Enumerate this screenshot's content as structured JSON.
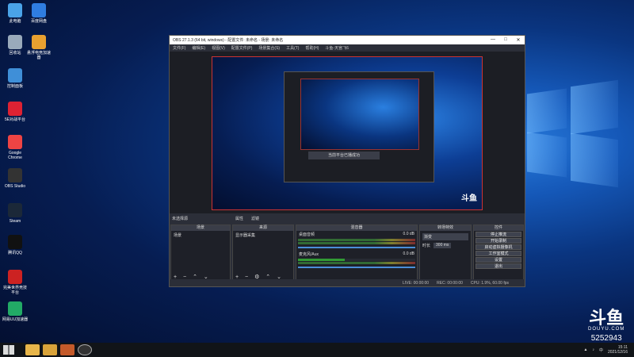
{
  "desktop_icons": [
    {
      "label": "此电脑",
      "color": "#4aa3e8"
    },
    {
      "label": "百度网盘",
      "color": "#2f7de1"
    },
    {
      "label": "回收站",
      "color": "#9ab"
    },
    {
      "label": "悬浮电竞加速器",
      "color": "#e8a030"
    },
    {
      "label": "控制面板",
      "color": "#3f8fd8"
    },
    {
      "label": "5E对战平台",
      "color": "#d23"
    },
    {
      "label": "Google Chrome",
      "color": "#e44"
    },
    {
      "label": "OBS Studio",
      "color": "#333"
    },
    {
      "label": "Steam",
      "color": "#1b2838"
    },
    {
      "label": "腾讯QQ",
      "color": "#111"
    },
    {
      "label": "完美世界竞技平台",
      "color": "#c22"
    },
    {
      "label": "网易UU加速器",
      "color": "#2a6"
    }
  ],
  "obs": {
    "title": "OBS 27.1.3 (64 bit, windows) - 配置文件: 未命名 - 场景: 未命名",
    "menu": [
      "文件(F)",
      "编辑(E)",
      "视图(V)",
      "配置文件(P)",
      "场景集合(S)",
      "工具(T)",
      "帮助(H)",
      "斗鱼-天宫飞6"
    ],
    "scene_bar": {
      "label": "未选择源",
      "props": "属性",
      "filters": "滤镜"
    },
    "panels": {
      "scenes": {
        "title": "场景",
        "items": [
          "场景"
        ]
      },
      "sources": {
        "title": "来源",
        "items": [
          "显示器采集"
        ]
      },
      "mixer": {
        "title": "混音器",
        "tracks": [
          {
            "name": "桌面音频",
            "db": "0.0 dB"
          },
          {
            "name": "麦克风/Aux",
            "db": "0.0 dB"
          }
        ]
      },
      "transitions": {
        "title": "转场特效",
        "type": "渐变",
        "duration_label": "时长",
        "duration": "300 ms"
      },
      "controls": {
        "title": "控件",
        "buttons": [
          "停止推流",
          "开始录制",
          "启动虚拟摄像机",
          "工作室模式",
          "设置",
          "退出"
        ]
      }
    },
    "status": {
      "live": "LIVE: 00:00:00",
      "rec": "REC: 00:00:00",
      "cpu": "CPU: 1.9%, 60.00 fps"
    },
    "preview_center_text": "当前平台已播成功"
  },
  "watermark": {
    "brand": "斗鱼",
    "site": "DOUYU.COM",
    "room": "5252943"
  },
  "taskbar": {
    "time": "15:11",
    "date": "2021/12/16"
  }
}
